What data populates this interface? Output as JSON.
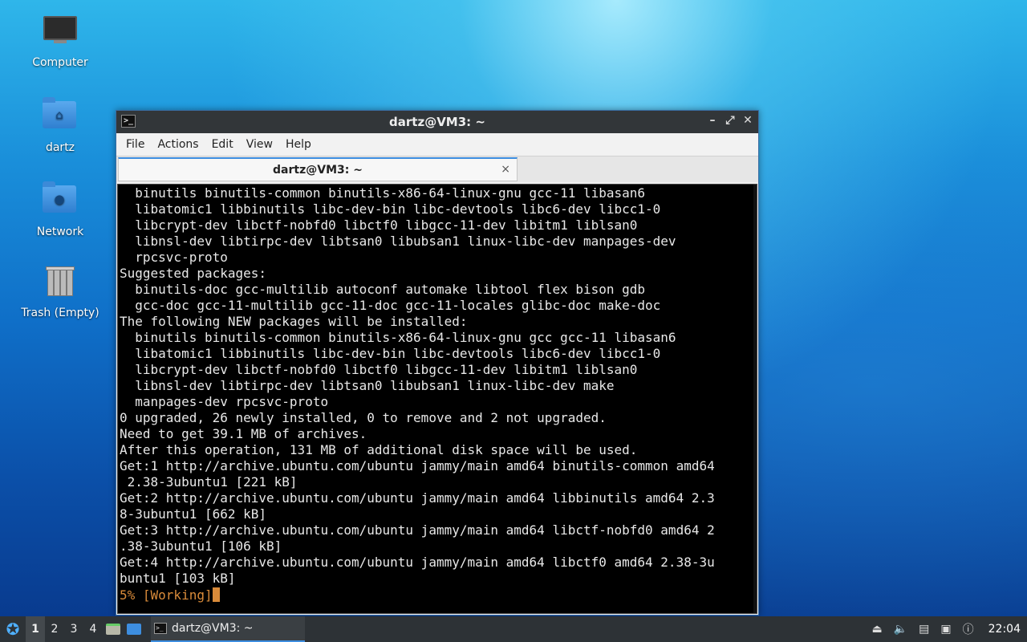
{
  "desktop": {
    "icons": [
      {
        "label": "Computer"
      },
      {
        "label": "dartz"
      },
      {
        "label": "Network"
      },
      {
        "label": "Trash (Empty)"
      }
    ]
  },
  "window": {
    "title": "dartz@VM3: ~",
    "menu": [
      "File",
      "Actions",
      "Edit",
      "View",
      "Help"
    ],
    "tab_label": "dartz@VM3: ~",
    "tab_close": "×",
    "buttons": {
      "minimize": "–",
      "maximize": "⤢",
      "close": "✕"
    }
  },
  "terminal": {
    "lines": [
      "  binutils binutils-common binutils-x86-64-linux-gnu gcc-11 libasan6",
      "  libatomic1 libbinutils libc-dev-bin libc-devtools libc6-dev libcc1-0",
      "  libcrypt-dev libctf-nobfd0 libctf0 libgcc-11-dev libitm1 liblsan0",
      "  libnsl-dev libtirpc-dev libtsan0 libubsan1 linux-libc-dev manpages-dev",
      "  rpcsvc-proto",
      "Suggested packages:",
      "  binutils-doc gcc-multilib autoconf automake libtool flex bison gdb",
      "  gcc-doc gcc-11-multilib gcc-11-doc gcc-11-locales glibc-doc make-doc",
      "The following NEW packages will be installed:",
      "  binutils binutils-common binutils-x86-64-linux-gnu gcc gcc-11 libasan6",
      "  libatomic1 libbinutils libc-dev-bin libc-devtools libc6-dev libcc1-0",
      "  libcrypt-dev libctf-nobfd0 libctf0 libgcc-11-dev libitm1 liblsan0",
      "  libnsl-dev libtirpc-dev libtsan0 libubsan1 linux-libc-dev make",
      "  manpages-dev rpcsvc-proto",
      "0 upgraded, 26 newly installed, 0 to remove and 2 not upgraded.",
      "Need to get 39.1 MB of archives.",
      "After this operation, 131 MB of additional disk space will be used.",
      "Get:1 http://archive.ubuntu.com/ubuntu jammy/main amd64 binutils-common amd64",
      " 2.38-3ubuntu1 [221 kB]",
      "Get:2 http://archive.ubuntu.com/ubuntu jammy/main amd64 libbinutils amd64 2.3",
      "8-3ubuntu1 [662 kB]",
      "Get:3 http://archive.ubuntu.com/ubuntu jammy/main amd64 libctf-nobfd0 amd64 2",
      ".38-3ubuntu1 [106 kB]",
      "Get:4 http://archive.ubuntu.com/ubuntu jammy/main amd64 libctf0 amd64 2.38-3u",
      "buntu1 [103 kB]"
    ],
    "progress_line": "5% [Working]"
  },
  "taskbar": {
    "workspaces": [
      "1",
      "2",
      "3",
      "4"
    ],
    "task_label": "dartz@VM3: ~",
    "clock": "22:04"
  }
}
